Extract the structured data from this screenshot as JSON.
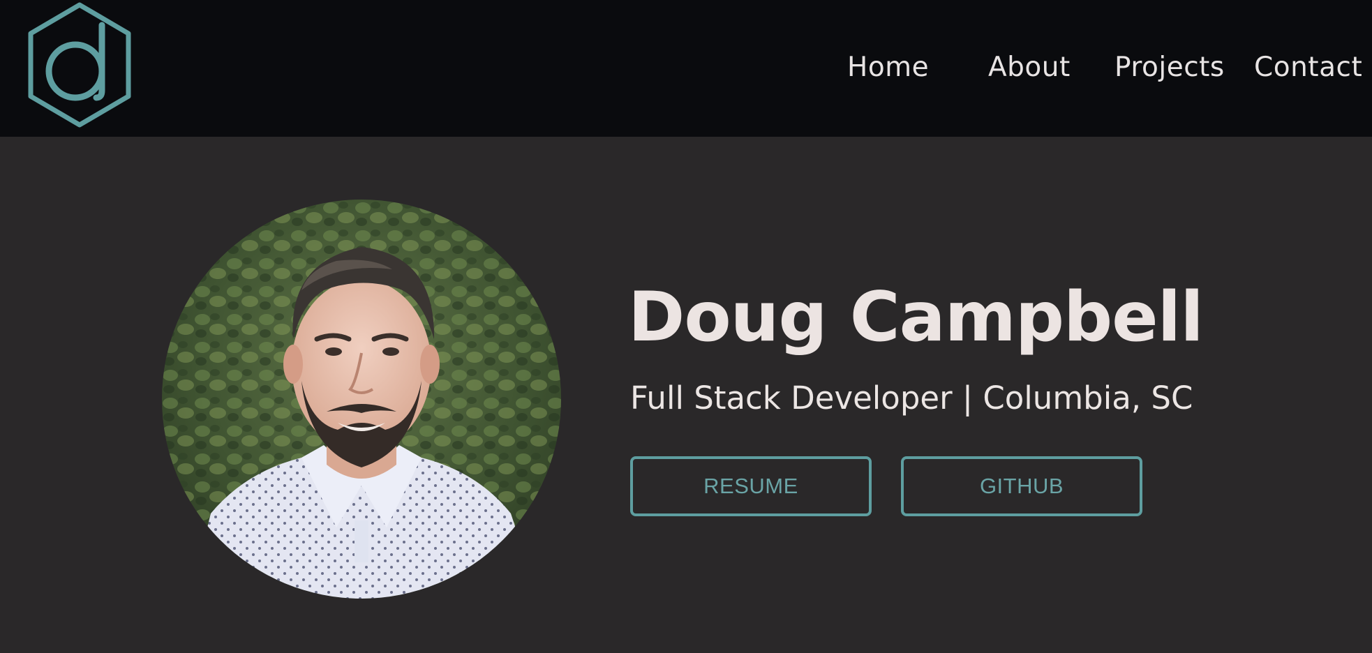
{
  "nav": {
    "logo_icon": "hexagon-d-logo-icon",
    "links": [
      "Home",
      "About",
      "Projects",
      "Contact"
    ]
  },
  "hero": {
    "name": "Doug Campbell",
    "subtitle": "Full Stack Developer | Columbia, SC",
    "buttons": {
      "resume": "RESUME",
      "github": "GITHUB"
    }
  },
  "colors": {
    "nav_background": "#0a0b0e",
    "page_background": "#2a2829",
    "accent": "#5e9ea0",
    "text": "#ece4e2"
  }
}
